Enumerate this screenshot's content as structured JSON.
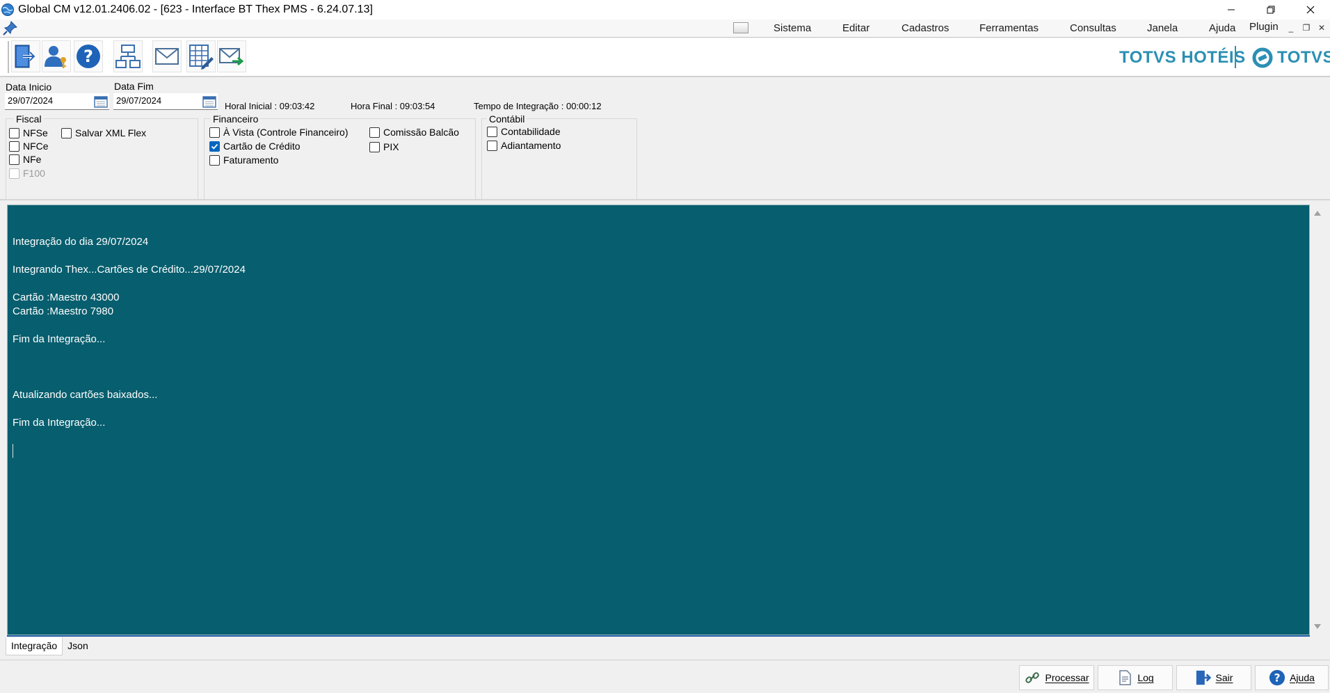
{
  "window": {
    "title": "Global CM v12.01.2406.02 - [623 - Interface BT Thex PMS - 6.24.07.13]"
  },
  "menu": {
    "items": [
      "Sistema",
      "Editar",
      "Cadastros",
      "Ferramentas",
      "Consultas",
      "Janela",
      "Ajuda",
      "Plugin"
    ]
  },
  "toolbar": {
    "icons": [
      "exit-icon",
      "user-key-icon",
      "help-icon",
      "network-icon",
      "mail-icon",
      "spreadsheet-edit-icon",
      "mail-send-icon"
    ]
  },
  "brand": {
    "hoteis": "TOTVS HOTÉIS",
    "totvs": "TOTVS",
    "color": "#2b8fb3"
  },
  "filters": {
    "data_inicio_label": "Data Inicio",
    "data_inicio_value": "29/07/2024",
    "data_fim_label": "Data Fim",
    "data_fim_value": "29/07/2024",
    "hora_inicial": "Horal Inicial : 09:03:42",
    "hora_final": "Hora Final : 09:03:54",
    "tempo": "Tempo de Integração :  00:00:12"
  },
  "fiscal": {
    "title": "Fiscal",
    "nfse": "NFSe",
    "nfce": "NFCe",
    "nfe": "NFe",
    "f100": "F100",
    "salvar_xml": "Salvar XML Flex"
  },
  "financeiro": {
    "title": "Financeiro",
    "a_vista": "À Vista (Controle Financeiro)",
    "cartao": "Cartão de Crédito",
    "faturamento": "Faturamento",
    "comissao": "Comissão Balcão",
    "pix": "PIX"
  },
  "contabil": {
    "title": "Contábil",
    "contabilidade": "Contabilidade",
    "adiantamento": "Adiantamento"
  },
  "log": {
    "background": "#075e6e",
    "lines": [
      "Integração do dia 29/07/2024",
      "Integrando Thex...Cartões de Crédito...29/07/2024",
      "Cartão :Maestro 43000",
      "Cartão :Maestro 7980",
      "Fim da Integração...",
      "Atualizando cartões baixados...",
      "Fim da Integração..."
    ]
  },
  "tabs": [
    "Integração",
    "Json"
  ],
  "buttons": {
    "processar": "Processar",
    "log": "Log",
    "sair": "Sair",
    "ajuda": "Ajuda"
  }
}
